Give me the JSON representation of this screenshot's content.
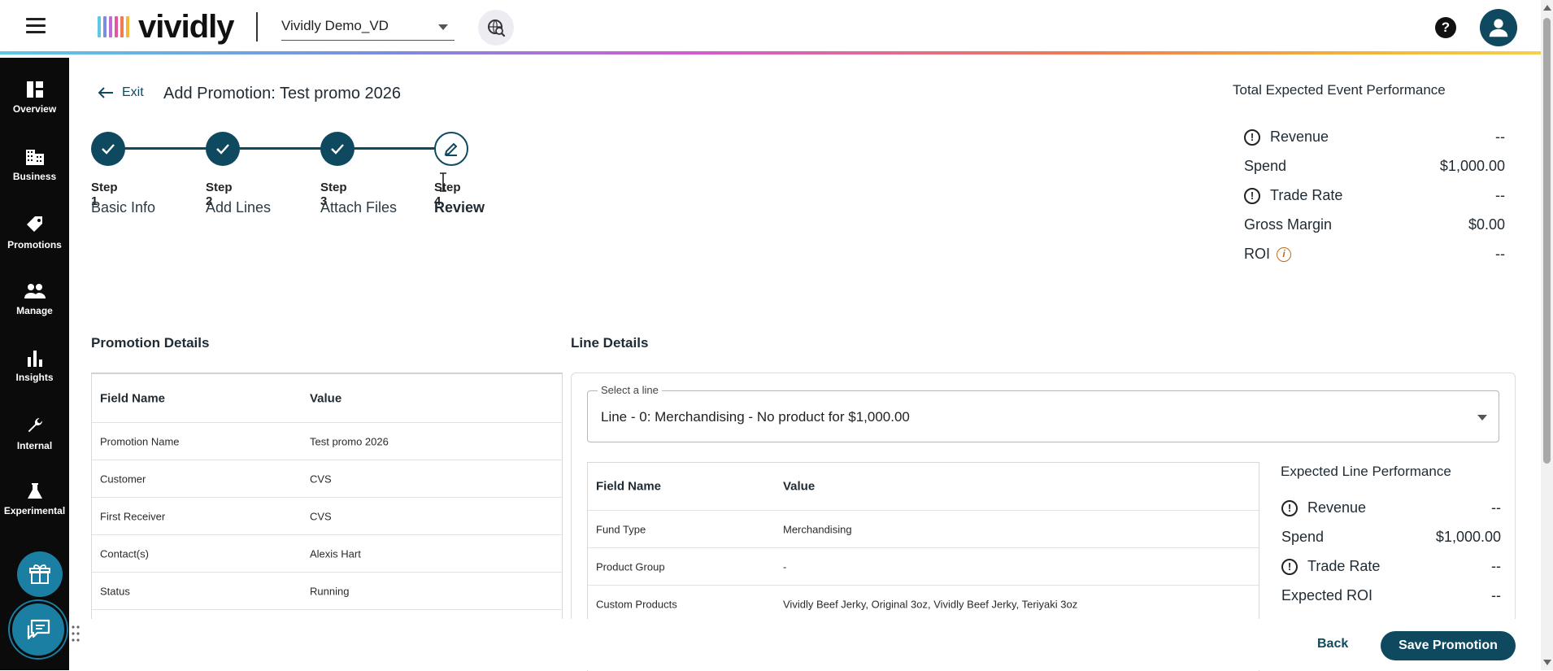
{
  "header": {
    "logo_text": "vividly",
    "logo_colors": [
      "#5ec8e6",
      "#7a8de0",
      "#c26ad8",
      "#e2579e",
      "#f07a52",
      "#f3b83a"
    ],
    "account": "Vividly Demo_VD",
    "icons": {
      "menu": "hamburger-menu-icon",
      "search": "search-globe-icon",
      "help": "help-icon",
      "user": "user-icon"
    },
    "help_glyph": "?"
  },
  "sidebar": {
    "items": [
      {
        "label": "Overview",
        "icon": "dashboard-icon"
      },
      {
        "label": "Business",
        "icon": "building-icon"
      },
      {
        "label": "Promotions",
        "icon": "tag-icon"
      },
      {
        "label": "Manage",
        "icon": "people-icon"
      },
      {
        "label": "Insights",
        "icon": "bar-chart-icon"
      },
      {
        "label": "Internal",
        "icon": "wrench-icon"
      },
      {
        "label": "Experimental",
        "icon": "flask-icon"
      }
    ],
    "gift_icon": "gift-icon",
    "chat_icon": "chat-icon"
  },
  "page": {
    "exit_label": "Exit",
    "title": "Add Promotion: Test promo 2026"
  },
  "steps": [
    {
      "num": "Step 1",
      "name": "Basic Info",
      "state": "complete"
    },
    {
      "num": "Step 2",
      "name": "Add Lines",
      "state": "complete"
    },
    {
      "num": "Step 3",
      "name": "Attach Files",
      "state": "complete"
    },
    {
      "num": "Step 4",
      "name": "Review",
      "state": "active"
    }
  ],
  "total_performance": {
    "title": "Total Expected Event Performance",
    "rows": [
      {
        "label": "Revenue",
        "value": "--",
        "icon": "warning-circle-icon"
      },
      {
        "label": "Spend",
        "value": "$1,000.00"
      },
      {
        "label": "Trade Rate",
        "value": "--",
        "icon": "warning-circle-icon"
      },
      {
        "label": "Gross Margin",
        "value": "$0.00"
      },
      {
        "label": "ROI",
        "value": "--",
        "info_icon": "info-icon"
      }
    ]
  },
  "promotion_details": {
    "title": "Promotion Details",
    "headers": [
      "Field Name",
      "Value"
    ],
    "rows": [
      [
        "Promotion Name",
        "Test promo 2026"
      ],
      [
        "Customer",
        "CVS"
      ],
      [
        "First Receiver",
        "CVS"
      ],
      [
        "Contact(s)",
        "Alexis Hart"
      ],
      [
        "Status",
        "Running"
      ]
    ]
  },
  "line_details": {
    "title": "Line Details",
    "select_label": "Select a line",
    "select_value": "Line - 0: Merchandising - No product for $1,000.00",
    "headers": [
      "Field Name",
      "Value"
    ],
    "rows": [
      [
        "Fund Type",
        "Merchandising"
      ],
      [
        "Product Group",
        "-"
      ],
      [
        "Custom Products",
        "Vividly Beef Jerky, Original 3oz, Vividly Beef Jerky, Teriyaki 3oz"
      ]
    ]
  },
  "line_performance": {
    "title": "Expected Line Performance",
    "rows": [
      {
        "label": "Revenue",
        "value": "--",
        "icon": "warning-circle-icon"
      },
      {
        "label": "Spend",
        "value": "$1,000.00"
      },
      {
        "label": "Trade Rate",
        "value": "--",
        "icon": "warning-circle-icon"
      },
      {
        "label": "Expected ROI",
        "value": "--"
      }
    ]
  },
  "footer": {
    "back_label": "Back",
    "save_label": "Save Promotion"
  },
  "colors": {
    "primary": "#0f4960",
    "sidebar_bg": "#0b0b0c",
    "float_btn": "#1b7fa3",
    "warning": "#c46a17"
  }
}
